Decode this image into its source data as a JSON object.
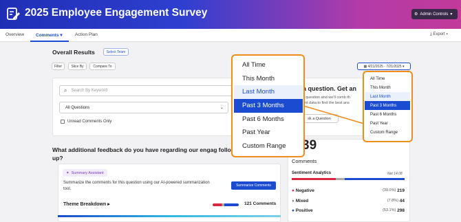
{
  "header": {
    "title": "2025 Employee Engagement Survey",
    "admin_label": "Admin Controls"
  },
  "nav": {
    "tabs": [
      "Overview",
      "Comments",
      "Action Plan"
    ],
    "export_label": "Export"
  },
  "main": {
    "title": "Overall Results",
    "select_team": "Select Team",
    "filters": [
      "Filter",
      "Slice By",
      "Compare To"
    ],
    "date_range": "4/21/2025 - 7/21/2025",
    "search_placeholder": "Search By Keyword",
    "questions_select": "All Questions",
    "unread_label": "Unread Comments Only",
    "ask_heading_suffix": "a question. Get an",
    "ask_text_1": "y question and we'll comb th",
    "ask_text_2": "ent data to find the best ans",
    "ask_button": "sk a Question",
    "question_text": "What additional feedback do you have regarding our engag follow-up?",
    "assistant_label": "Summary Assistant",
    "assistant_text": "Summarize the comments for this question using our AI-powered summarization tool.",
    "summarize_button": "Summarize Comments",
    "theme_label": "Theme Breakdown",
    "theme_count": "121 Comments",
    "big_number": "39",
    "comments_label": "Comments",
    "sentiment_title": "Sentiment Analytics",
    "net_label": "Net 14.08",
    "sentiments": [
      {
        "label": "Negative",
        "pct": "(39.0%)",
        "count": "219",
        "color": "#d9263f"
      },
      {
        "label": "Mixed",
        "pct": "(7.8%)",
        "count": "44",
        "color": "#888888"
      },
      {
        "label": "Positive",
        "pct": "(53.1%)",
        "count": "298",
        "color": "#1a4bd0"
      }
    ]
  },
  "range_options": [
    "All Time",
    "This Month",
    "Last Month",
    "Past 3 Months",
    "Past 6 Months",
    "Past Year",
    "Custom Range"
  ]
}
